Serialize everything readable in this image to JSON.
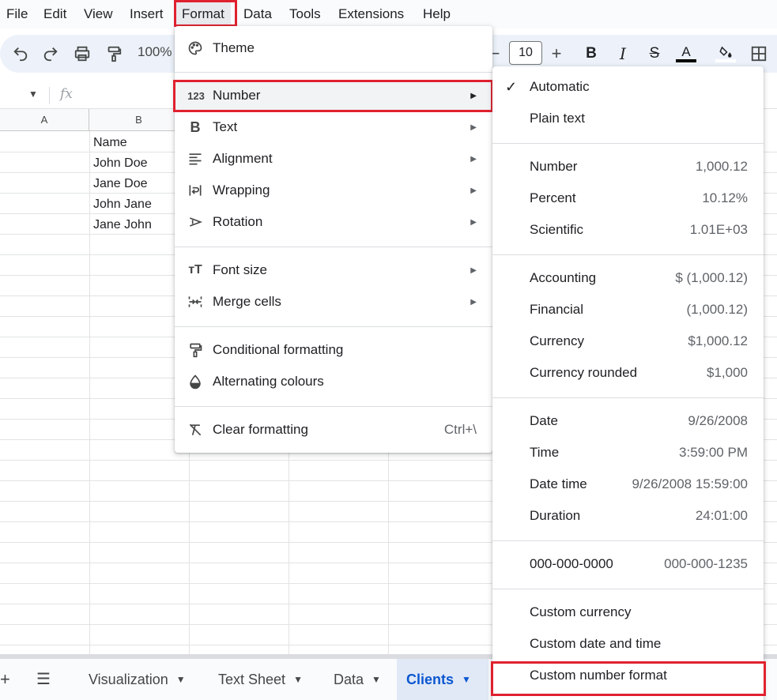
{
  "menubar": {
    "items": [
      "File",
      "Edit",
      "View",
      "Insert",
      "Format",
      "Data",
      "Tools",
      "Extensions",
      "Help"
    ]
  },
  "toolbar": {
    "zoom": "100%",
    "font_size": "10",
    "icons": [
      "undo-icon",
      "redo-icon",
      "print-icon",
      "paint-format-icon",
      "decrease-font-size-icon",
      "increase-font-size-icon",
      "bold-icon",
      "italic-icon",
      "strikethrough-icon",
      "text-color-icon",
      "fill-color-icon",
      "borders-icon"
    ]
  },
  "formula_bar": {
    "fx": "fx"
  },
  "grid": {
    "columns": [
      "A",
      "B"
    ],
    "cells": [
      "Name",
      "John Doe",
      "Jane Doe",
      "John Jane",
      "Jane John"
    ]
  },
  "format_menu": {
    "items": [
      {
        "label": "Theme",
        "icon": "palette-icon"
      },
      {
        "label": "Number",
        "icon": "number-123-icon",
        "submenu": true
      },
      {
        "label": "Text",
        "icon": "bold-b-icon",
        "submenu": true
      },
      {
        "label": "Alignment",
        "icon": "align-left-icon",
        "submenu": true
      },
      {
        "label": "Wrapping",
        "icon": "text-wrap-icon",
        "submenu": true
      },
      {
        "label": "Rotation",
        "icon": "text-rotation-icon",
        "submenu": true
      },
      {
        "label": "Font size",
        "icon": "font-size-icon",
        "submenu": true
      },
      {
        "label": "Merge cells",
        "icon": "merge-cells-icon",
        "submenu": true
      },
      {
        "label": "Conditional formatting",
        "icon": "paint-roller-icon"
      },
      {
        "label": "Alternating colours",
        "icon": "color-drop-icon"
      },
      {
        "label": "Clear formatting",
        "icon": "clear-format-icon",
        "shortcut": "Ctrl+\\"
      }
    ]
  },
  "number_menu": {
    "items": [
      {
        "label": "Automatic",
        "example": "",
        "checked": true
      },
      {
        "label": "Plain text",
        "example": ""
      },
      {
        "label": "Number",
        "example": "1,000.12"
      },
      {
        "label": "Percent",
        "example": "10.12%"
      },
      {
        "label": "Scientific",
        "example": "1.01E+03"
      },
      {
        "label": "Accounting",
        "example": "$ (1,000.12)"
      },
      {
        "label": "Financial",
        "example": "(1,000.12)"
      },
      {
        "label": "Currency",
        "example": "$1,000.12"
      },
      {
        "label": "Currency rounded",
        "example": "$1,000"
      },
      {
        "label": "Date",
        "example": "9/26/2008"
      },
      {
        "label": "Time",
        "example": "3:59:00 PM"
      },
      {
        "label": "Date time",
        "example": "9/26/2008 15:59:00"
      },
      {
        "label": "Duration",
        "example": "24:01:00"
      },
      {
        "label": "000-000-0000",
        "example": "000-000-1235"
      },
      {
        "label": "Custom currency",
        "example": ""
      },
      {
        "label": "Custom date and time",
        "example": ""
      },
      {
        "label": "Custom number format",
        "example": ""
      }
    ],
    "check_mark": "✓"
  },
  "sheet_bar": {
    "add": "+",
    "all_sheets": "☰",
    "tabs": [
      "Visualization",
      "Text Sheet",
      "Data",
      "Clients"
    ],
    "active_tab": "Clients"
  },
  "highlight_color": "#e0212f",
  "accent_color": "#0b57d0"
}
